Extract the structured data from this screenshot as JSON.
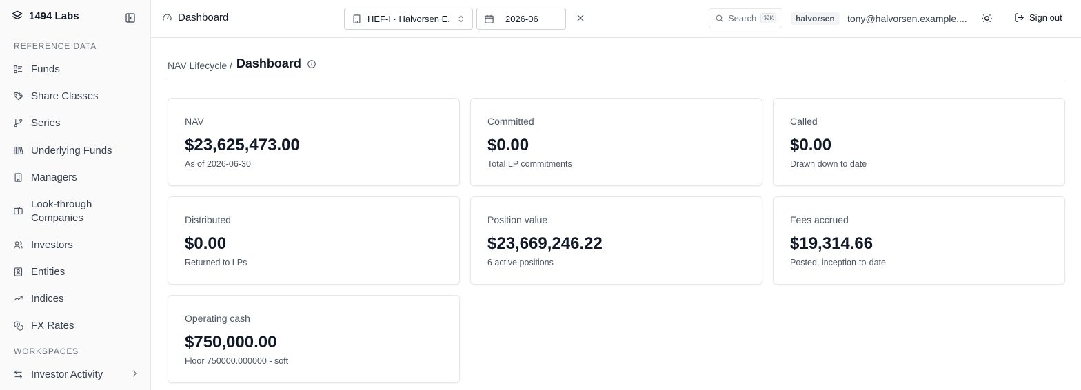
{
  "brand": {
    "name": "1494 Labs"
  },
  "sidebar": {
    "sections": [
      {
        "label": "REFERENCE DATA"
      },
      {
        "label": "WORKSPACES"
      }
    ],
    "items": [
      {
        "label": "Funds"
      },
      {
        "label": "Share Classes"
      },
      {
        "label": "Series"
      },
      {
        "label": "Underlying Funds"
      },
      {
        "label": "Managers"
      },
      {
        "label": "Look-through Companies"
      },
      {
        "label": "Investors"
      },
      {
        "label": "Entities"
      },
      {
        "label": "Indices"
      },
      {
        "label": "FX Rates"
      },
      {
        "label": "Investor Activity"
      }
    ]
  },
  "topbar": {
    "title": "Dashboard",
    "fund_select": "HEF-I · Halvorsen E...",
    "period": "2026-06",
    "search_placeholder": "Search",
    "search_shortcut": "⌘K",
    "tenant": "halvorsen",
    "user_email": "tony@halvorsen.example....",
    "sign_out": "Sign out"
  },
  "breadcrumb": {
    "parent": "NAV Lifecycle /",
    "current": "Dashboard"
  },
  "cards": [
    {
      "label": "NAV",
      "value": "$23,625,473.00",
      "sub": "As of 2026-06-30"
    },
    {
      "label": "Committed",
      "value": "$0.00",
      "sub": "Total LP commitments"
    },
    {
      "label": "Called",
      "value": "$0.00",
      "sub": "Drawn down to date"
    },
    {
      "label": "Distributed",
      "value": "$0.00",
      "sub": "Returned to LPs"
    },
    {
      "label": "Position value",
      "value": "$23,669,246.22",
      "sub": "6 active positions"
    },
    {
      "label": "Fees accrued",
      "value": "$19,314.66",
      "sub": "Posted, inception-to-date"
    },
    {
      "label": "Operating cash",
      "value": "$750,000.00",
      "sub": "Floor 750000.000000 - soft"
    }
  ],
  "colors": {
    "border": "#e5e7eb",
    "sidebar_bg": "#fafafa",
    "text": "#111827",
    "muted": "#4b5563"
  }
}
